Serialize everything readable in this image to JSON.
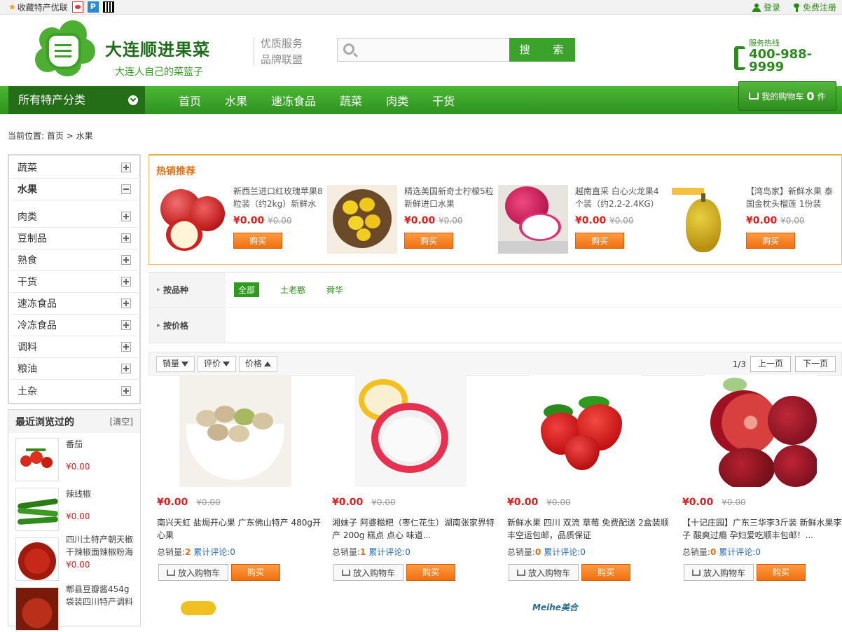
{
  "topbar": {
    "favorite": "收藏特产优联",
    "login": "登录",
    "register": "免费注册"
  },
  "header": {
    "brand_name": "大连顺进果菜",
    "slogan": "大连人自己的菜篮子",
    "service_line1": "优质服务",
    "service_line2": "品牌联盟",
    "search_placeholder": "",
    "search_button": "搜 索",
    "hotline_label": "服务热线",
    "hotline_number": "400-988-9999"
  },
  "nav": {
    "all_categories": "所有特产分类",
    "items": [
      "首页",
      "水果",
      "速冻食品",
      "蔬菜",
      "肉类",
      "干货"
    ],
    "cart_label": "我的购物车",
    "cart_count": "0",
    "cart_unit": "件"
  },
  "breadcrumb": {
    "prefix": "当前位置:",
    "home": "首页",
    "sep": ">",
    "current": "水果"
  },
  "categories": [
    {
      "label": "蔬菜",
      "state": "plus"
    },
    {
      "label": "水果",
      "state": "minus"
    },
    {
      "label": "肉类",
      "state": "plus"
    },
    {
      "label": "豆制品",
      "state": "plus"
    },
    {
      "label": "熟食",
      "state": "plus"
    },
    {
      "label": "干货",
      "state": "plus"
    },
    {
      "label": "速冻食品",
      "state": "plus"
    },
    {
      "label": "冷冻食品",
      "state": "plus"
    },
    {
      "label": "调料",
      "state": "plus"
    },
    {
      "label": "粮油",
      "state": "plus"
    },
    {
      "label": "土杂",
      "state": "plus"
    }
  ],
  "recent": {
    "title": "最近浏览过的",
    "clear": "[清空]",
    "items": [
      {
        "name": "番茄",
        "price": "¥0.00"
      },
      {
        "name": "辣线椒",
        "price": "¥0.00"
      },
      {
        "name": "四川土特产朝天椒干辣椒面辣椒粉海",
        "price": "¥0.00"
      },
      {
        "name": "郫县豆瓣酱454g袋装四川特产调料",
        "price": ""
      }
    ]
  },
  "hot": {
    "title": "热销推荐",
    "items": [
      {
        "name": "新西兰进口红玫瑰苹果8粒装（约2kg）新鲜水",
        "price": "¥0.00",
        "old_price": "¥0.00",
        "buy": "购买"
      },
      {
        "name": "精选美国新奇士柠檬5粒 新鲜进口水果",
        "price": "¥0.00",
        "old_price": "¥0.00",
        "buy": "购买"
      },
      {
        "name": "越南直采 白心火龙果4个装（约2.2-2.4KG）",
        "price": "¥0.00",
        "old_price": "¥0.00",
        "buy": "购买"
      },
      {
        "name": "【湾岛家】新鲜水果 泰国金枕头榴莲 1份装",
        "price": "¥0.00",
        "old_price": "¥0.00",
        "buy": "购买"
      }
    ]
  },
  "filters": {
    "breed_label": "按品种",
    "breed_options": [
      "全部",
      "土老憨",
      "舜华"
    ],
    "price_label": "按价格"
  },
  "sort": {
    "sales": "销量",
    "reviews": "评价",
    "price": "价格",
    "page_info": "1/3",
    "prev": "上一页",
    "next": "下一页"
  },
  "products": [
    {
      "name": "南兴天虹 盐焗开心果 广东佛山特产 480g开心果",
      "price": "¥0.00",
      "old_price": "¥0.00",
      "sales_label": "总销量:",
      "sales": "2",
      "reviews_label": "累计评论:",
      "reviews": "0",
      "add_cart": "放入购物车",
      "buy": "购买"
    },
    {
      "name": "湘妹子 阿婆糍粑（枣仁花生）湖南张家界特产 200g 糕点 点心 味道...",
      "price": "¥0.00",
      "old_price": "¥0.00",
      "sales_label": "总销量:",
      "sales": "1",
      "reviews_label": "累计评论:",
      "reviews": "0",
      "add_cart": "放入购物车",
      "buy": "购买"
    },
    {
      "name": "新鲜水果 四川 双流 草莓 免费配送 2盒装顺丰空运包邮，品质保证",
      "price": "¥0.00",
      "old_price": "¥0.00",
      "sales_label": "总销量:",
      "sales": "0",
      "reviews_label": "累计评论:",
      "reviews": "0",
      "add_cart": "放入购物车",
      "buy": "购买"
    },
    {
      "name": "【十记庄园】广东三华李3斤装 新鲜水果李子 酸爽过瘾 孕妇爱吃顺丰包邮！...",
      "price": "¥0.00",
      "old_price": "¥0.00",
      "sales_label": "总销量:",
      "sales": "0",
      "reviews_label": "累计评论:",
      "reviews": "0",
      "add_cart": "放入购物车",
      "buy": "购买"
    }
  ],
  "bottom_brands": [
    "",
    "Meihe美合"
  ],
  "colors": {
    "brand_green": "#3ba22c",
    "nav_dark": "#236e17",
    "price_red": "#e02020",
    "buy_orange": "#f07010"
  }
}
